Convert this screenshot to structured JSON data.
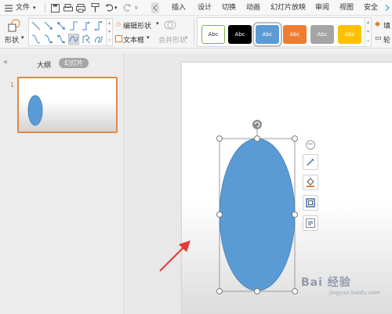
{
  "menubar": {
    "file": "文件",
    "tabs": [
      "插入",
      "设计",
      "切换",
      "动画",
      "幻灯片放映",
      "审阅",
      "视图",
      "安全"
    ]
  },
  "ribbon": {
    "shape_label": "形状",
    "edit_shape": "编辑形状",
    "text_box": "文本框",
    "merge_shapes": "合并形状",
    "style_text": "Abc",
    "styles": [
      {
        "bg": "#ffffff",
        "fg": "#333333",
        "border": "#7cb342"
      },
      {
        "bg": "#000000",
        "fg": "#ffffff",
        "border": "#000000"
      },
      {
        "bg": "#5b9bd5",
        "fg": "#ffffff",
        "border": "#5b9bd5"
      },
      {
        "bg": "#ed7d31",
        "fg": "#ffffff",
        "border": "#ed7d31"
      },
      {
        "bg": "#a5a5a5",
        "fg": "#ffffff",
        "border": "#a5a5a5"
      },
      {
        "bg": "#ffc000",
        "fg": "#ffffff",
        "border": "#ffc000"
      }
    ],
    "fill_partial": "填",
    "outline_partial": "轮"
  },
  "left_panel": {
    "tab_outline": "大纲",
    "tab_slides": "幻灯片",
    "slide_number": "1",
    "collapse": "«"
  },
  "shape": {
    "fill": "#5b9bd5",
    "stroke": "#4a86bf"
  },
  "arrow_color": "#e53935",
  "watermark": {
    "text": "Bai 经验",
    "sub": "jingyan.baidu.com"
  }
}
